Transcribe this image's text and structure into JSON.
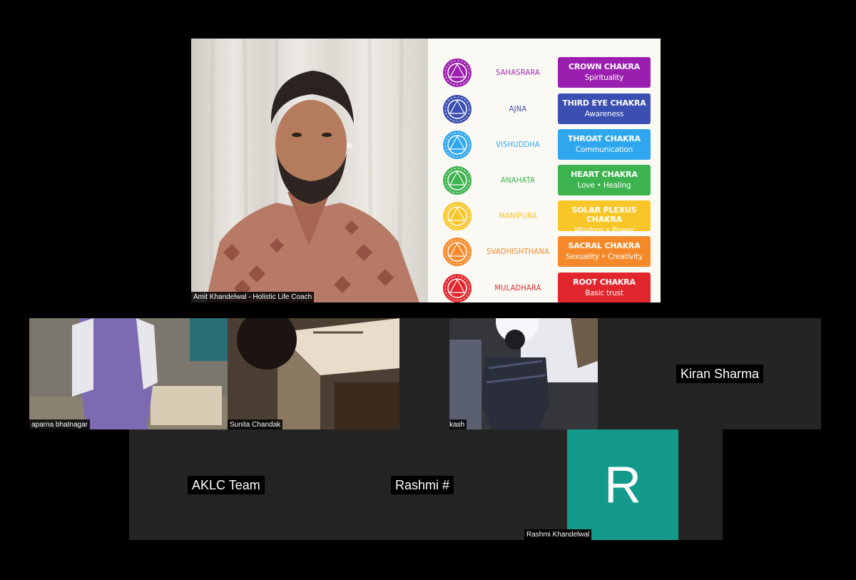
{
  "featured": {
    "speaker_label": "Amit Khandelwal - Holistic Life Coach",
    "chakras": [
      {
        "name": "SAHASRARA",
        "title": "CROWN CHAKRA",
        "subtitle": "Spirituality",
        "color": "#9b1fae",
        "name_color": "#a12ab1"
      },
      {
        "name": "AJNA",
        "title": "THIRD EYE CHAKRA",
        "subtitle": "Awareness",
        "color": "#3a4fb1",
        "name_color": "#3a4fb1"
      },
      {
        "name": "VISHUDDHA",
        "title": "THROAT CHAKRA",
        "subtitle": "Communication",
        "color": "#2fa7ee",
        "name_color": "#2fa7ee"
      },
      {
        "name": "ANAHATA",
        "title": "HEART CHAKRA",
        "subtitle": "Love • Healing",
        "color": "#3db34f",
        "name_color": "#3db34f"
      },
      {
        "name": "MANIPURA",
        "title": "SOLAR PLEXUS CHAKRA",
        "subtitle": "Wisdom • Power",
        "color": "#f9c62a",
        "name_color": "#f6c12c"
      },
      {
        "name": "SVADHISHTHANA",
        "title": "SACRAL CHAKRA",
        "subtitle": "Sexuality • Creativity",
        "color": "#f5892a",
        "name_color": "#f08a2c"
      },
      {
        "name": "MULADHARA",
        "title": "ROOT CHAKRA",
        "subtitle": "Basic trust",
        "color": "#e2262d",
        "name_color": "#e02a2f"
      }
    ]
  },
  "participants": {
    "aparna": "aparna bhatnagar",
    "sunita": "Sunita Chandak",
    "om": "om prakash",
    "kiran": "Kiran Sharma",
    "aklc": "AKLC Team",
    "rashmi_hash": "Rashmi #",
    "rashmi_k": "Rashmi Khandelwal",
    "rashmi_k_initial": "R"
  },
  "colors": {
    "background": "#000000",
    "tile": "#242424",
    "avatar": "#139a8a"
  }
}
